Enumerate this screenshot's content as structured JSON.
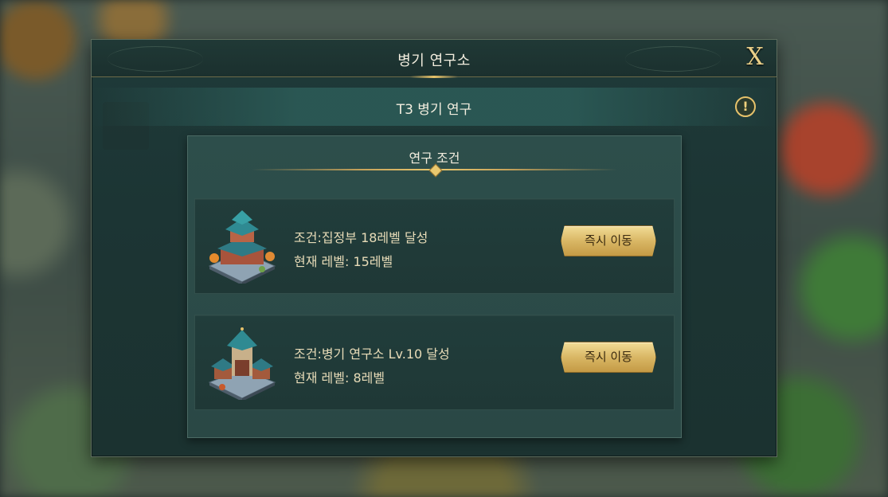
{
  "panel": {
    "title": "병기 연구소",
    "close_label": "X"
  },
  "research": {
    "title": "T3 병기 연구",
    "info_icon": "!"
  },
  "conditions": {
    "title": "연구 조건",
    "items": [
      {
        "condition": "조건:집정부 18레벨 달성",
        "current": "현재 레벨: 15레벨",
        "button": "즉시 이동",
        "icon": "town-hall-building-icon"
      },
      {
        "condition": "조건:병기 연구소 Lv.10 달성",
        "current": "현재 레벨: 8레벨",
        "button": "즉시 이동",
        "icon": "siege-workshop-building-icon"
      }
    ]
  },
  "colors": {
    "accent_gold": "#e9c86f",
    "panel_bg": "#1f3a39",
    "text_light": "#f3eedf",
    "text_cond": "#e8dcb8"
  }
}
